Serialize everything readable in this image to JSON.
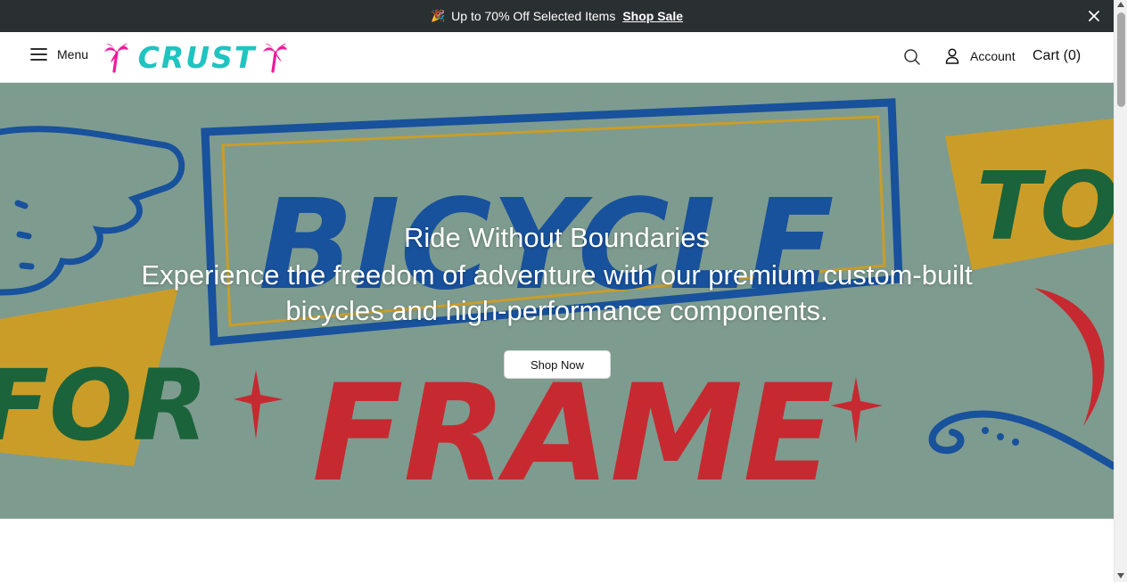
{
  "announcement": {
    "emoji": "🎉",
    "text": "Up to 70% Off Selected Items",
    "link": "Shop Sale"
  },
  "header": {
    "menu_label": "Menu",
    "logo_text": "CRUST",
    "account_label": "Account",
    "cart_label": "Cart (0)"
  },
  "hero": {
    "title": "Ride Without Boundaries",
    "subtitle": "Experience the freedom of adventure with our premium custom-built bicycles and high-performance components.",
    "button_label": "Shop Now",
    "background_art_words": [
      "BICYCLE",
      "TO",
      "FOR",
      "FRAME"
    ]
  },
  "colors": {
    "announcement_bg": "#2a2f31",
    "logo_teal": "#1fc4c0",
    "logo_palm": "#f0199a",
    "hero_bg": "#86a598",
    "sign_blue": "#1a57a6",
    "sign_red": "#d32d34",
    "sign_green": "#1d6a3f",
    "sign_yellow": "#d7a72c"
  },
  "icons": [
    "party-popper-icon",
    "close-icon",
    "hamburger-menu-icon",
    "palm-tree-icon",
    "search-icon",
    "user-icon"
  ]
}
